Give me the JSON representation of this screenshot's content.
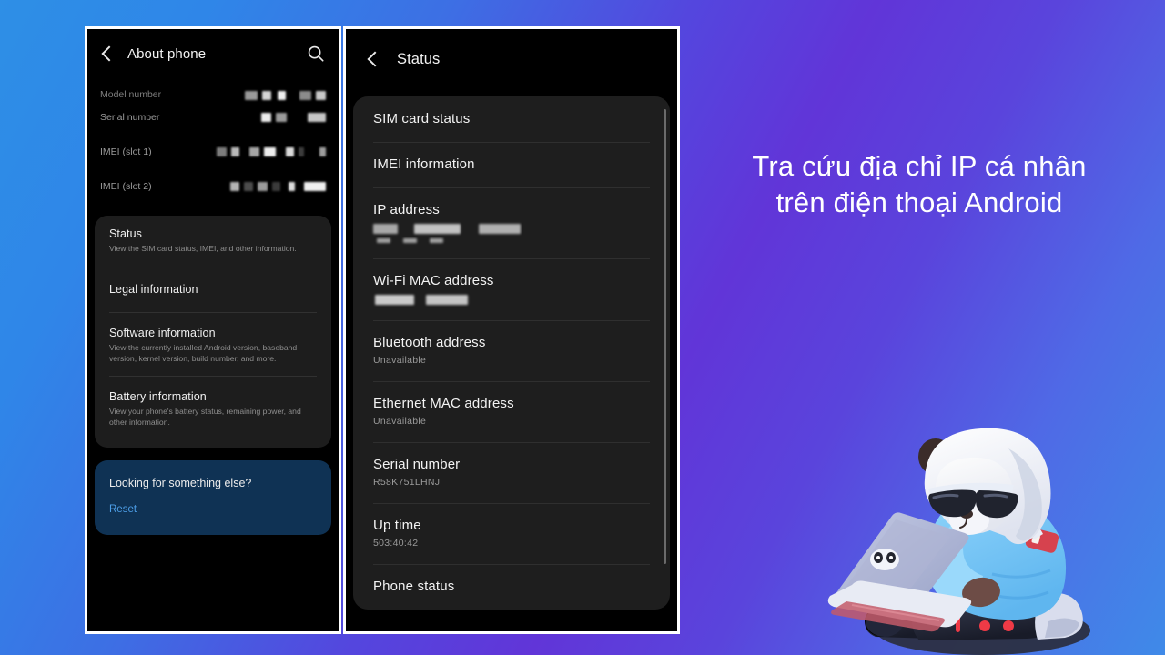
{
  "background": {
    "gradient_from": "#2e8fe6",
    "gradient_mid": "#6135d8",
    "gradient_to": "#3f8ae8"
  },
  "headline": {
    "line1": "Tra cứu địa chỉ IP cá nhân",
    "line2": "trên điện thoại Android"
  },
  "left_screen": {
    "appbar": {
      "title": "About phone",
      "back_icon": "chevron-left-icon",
      "search_icon": "search-icon"
    },
    "info_rows": [
      {
        "key": "Model number",
        "value_redacted": true
      },
      {
        "key": "Serial number",
        "value_redacted": true
      },
      {
        "key": "IMEI (slot 1)",
        "value_redacted": true
      },
      {
        "key": "IMEI (slot 2)",
        "value_redacted": true
      }
    ],
    "menu_items": [
      {
        "title": "Status",
        "subtitle": "View the SIM card status, IMEI, and other information."
      },
      {
        "title": "Legal information",
        "subtitle": ""
      },
      {
        "title": "Software information",
        "subtitle": "View the currently installed Android version, baseband version, kernel version, build number, and more."
      },
      {
        "title": "Battery information",
        "subtitle": "View your phone's battery status, remaining power, and other information."
      }
    ],
    "promo_card": {
      "title": "Looking for something else?",
      "link": "Reset",
      "bg_color": "#0f3254",
      "link_color": "#4d9fe8"
    }
  },
  "right_screen": {
    "appbar": {
      "title": "Status",
      "back_icon": "chevron-left-icon"
    },
    "items": [
      {
        "title": "SIM card status",
        "value": "",
        "redacted": false
      },
      {
        "title": "IMEI information",
        "value": "",
        "redacted": false
      },
      {
        "title": "IP address",
        "value": "",
        "redacted": true
      },
      {
        "title": "Wi-Fi MAC address",
        "value": "",
        "redacted": true
      },
      {
        "title": "Bluetooth address",
        "value": "Unavailable",
        "redacted": false
      },
      {
        "title": "Ethernet MAC address",
        "value": "Unavailable",
        "redacted": false
      },
      {
        "title": "Serial number",
        "value": "R58K751LHNJ",
        "redacted": false
      },
      {
        "title": "Up time",
        "value": "503:40:42",
        "redacted": false
      },
      {
        "title": "Phone status",
        "value": "",
        "redacted": false
      }
    ],
    "scrollbar": "vertical-scrollbar"
  },
  "mascot": {
    "name": "panda-with-laptop-illustration",
    "description": "3D panda wearing sunglasses, white hood and blue jacket, using a laptop"
  }
}
